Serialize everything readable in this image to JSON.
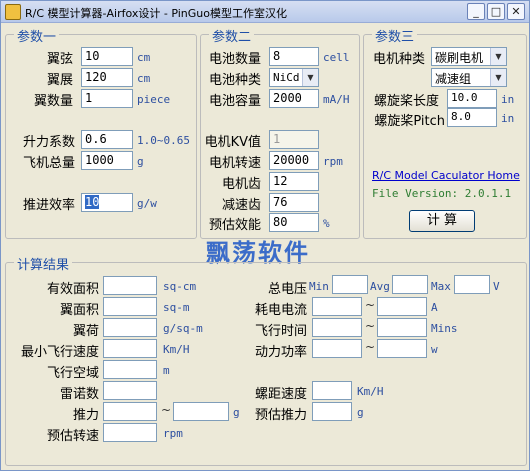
{
  "window": {
    "title": "R/C 模型计算器-Airfox设计 - PinGuo模型工作室汉化",
    "minimize": "_",
    "maximize": "□",
    "close": "✕"
  },
  "params1": {
    "legend": "参数一",
    "wing_chord": {
      "label": "翼弦",
      "value": "10",
      "unit": "cm"
    },
    "wing_span": {
      "label": "翼展",
      "value": "120",
      "unit": "cm"
    },
    "wing_count": {
      "label": "翼数量",
      "value": "1",
      "unit": "piece"
    },
    "lift_coef": {
      "label": "升力系数",
      "value": "0.6",
      "unit": "1.0~0.65"
    },
    "total_weight": {
      "label": "飞机总量",
      "value": "1000",
      "unit": "g"
    },
    "efficiency": {
      "label": "推进效率",
      "value": "10",
      "unit": "g/w"
    }
  },
  "params2": {
    "legend": "参数二",
    "battery_count": {
      "label": "电池数量",
      "value": "8",
      "unit": "cell"
    },
    "battery_type": {
      "label": "电池种类",
      "value": "NiCd"
    },
    "battery_capacity": {
      "label": "电池容量",
      "value": "2000",
      "unit": "mA/H"
    },
    "motor_kv": {
      "label": "电机KV值",
      "value": "1"
    },
    "motor_speed": {
      "label": "电机转速",
      "value": "20000",
      "unit": "rpm"
    },
    "motor_teeth": {
      "label": "电机齿",
      "value": "12"
    },
    "gear_teeth": {
      "label": "减速齿",
      "value": "76"
    },
    "est_efficiency": {
      "label": "预估效能",
      "value": "80",
      "unit": "%"
    }
  },
  "params3": {
    "legend": "参数三",
    "motor_type": {
      "label": "电机种类",
      "value": "碳刷电机"
    },
    "gearbox": {
      "value": "减速组"
    },
    "prop_length": {
      "label": "螺旋桨长度",
      "value": "10.0",
      "unit": "in"
    },
    "prop_pitch": {
      "label": "螺旋桨Pitch",
      "value": "8.0",
      "unit": "in"
    },
    "home_link": "R/C Model Caculator Home",
    "version": "File Version: 2.0.1.1",
    "calc_button": "计  算"
  },
  "watermark": "飘荡软件",
  "results": {
    "legend": "计算结果",
    "eff_area": {
      "label": "有效面积",
      "unit": "sq-cm"
    },
    "wing_area": {
      "label": "翼面积",
      "unit": "sq-m"
    },
    "wing_load": {
      "label": "翼荷",
      "unit": "g/sq-m"
    },
    "min_speed": {
      "label": "最小飞行速度",
      "unit": "Km/H"
    },
    "airspace": {
      "label": "飞行空域",
      "unit": "m"
    },
    "reynolds": {
      "label": "雷诺数"
    },
    "thrust": {
      "label": "推力",
      "unit": "g"
    },
    "est_rpm": {
      "label": "预估转速",
      "unit": "rpm"
    },
    "total_voltage": {
      "label": "总电压",
      "min": "Min",
      "avg": "Avg",
      "max": "Max",
      "unit": "V"
    },
    "current": {
      "label": "耗电电流",
      "unit": "A"
    },
    "flight_time": {
      "label": "飞行时间",
      "unit": "Mins"
    },
    "power": {
      "label": "动力功率",
      "unit": "w"
    },
    "pitch_speed": {
      "label": "螺距速度",
      "unit": "Km/H"
    },
    "est_thrust": {
      "label": "预估推力",
      "unit": "g"
    },
    "tilde": "~"
  }
}
